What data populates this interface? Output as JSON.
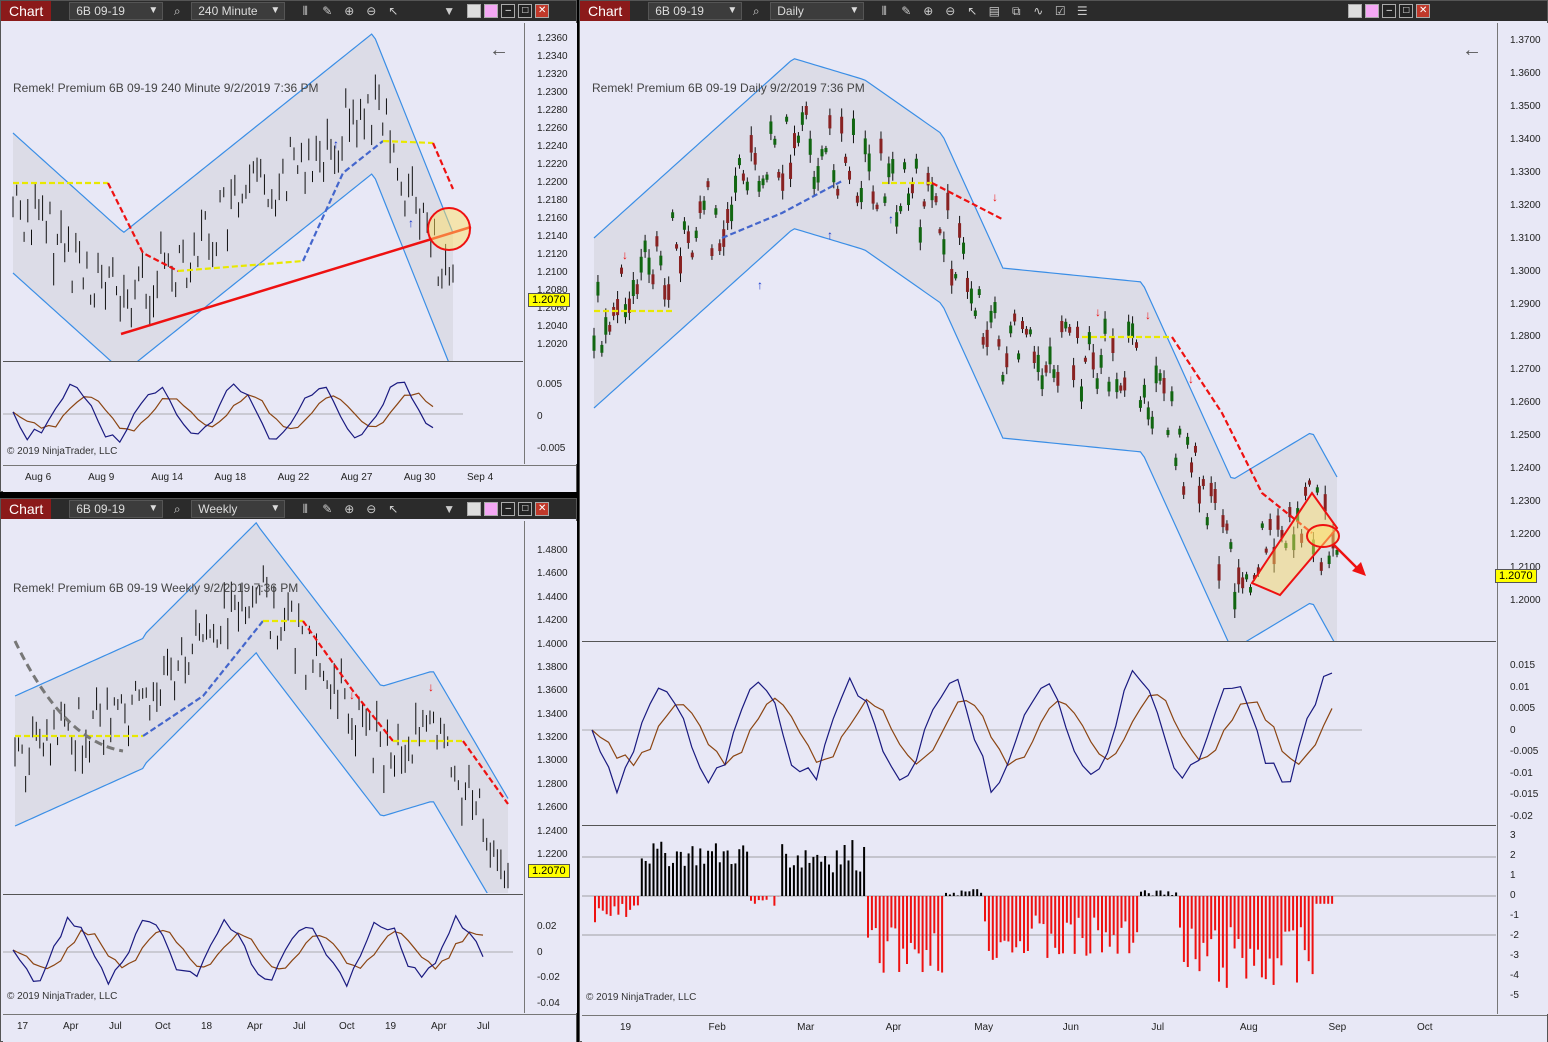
{
  "colors": {
    "band": "#3a8ee6",
    "downtrend": "#ee1111",
    "uptrend": "#4466cc",
    "neutral": "#e8e800",
    "accent": "#8b1a1a",
    "osc_fast": "#1a1a80",
    "osc_slow": "#8b4513",
    "hist_pos": "#000000",
    "hist_neg": "#ee1111"
  },
  "icons": [
    "search-icon",
    "bar-style-icon",
    "draw-icon",
    "zoom-in-icon",
    "zoom-out-icon",
    "cursor-icon",
    "chevron-down-icon",
    "minimize-icon",
    "maximize-icon",
    "close-icon",
    "back-arrow-icon"
  ],
  "win1": {
    "title": "Chart",
    "instrument": "6B 09-19",
    "interval": "240 Minute",
    "label": "Remek!  Premium  6B 09-19  240 Minute  9/2/2019 7:36 PM",
    "copyright": "© 2019 NinjaTrader, LLC",
    "price_badge": "1.2070",
    "y_ticks": [
      "1.2360",
      "1.2340",
      "1.2320",
      "1.2300",
      "1.2280",
      "1.2260",
      "1.2240",
      "1.2220",
      "1.2200",
      "1.2180",
      "1.2160",
      "1.2140",
      "1.2120",
      "1.2100",
      "1.2080",
      "1.2060",
      "1.2040",
      "1.2020"
    ],
    "osc_ticks": [
      "0.005",
      "0",
      "-0.005"
    ],
    "x_ticks": [
      "Aug 6",
      "Aug 9",
      "Aug 14",
      "Aug 18",
      "Aug 22",
      "Aug 27",
      "Aug 30",
      "Sep 4"
    ]
  },
  "win2": {
    "title": "Chart",
    "instrument": "6B 09-19",
    "interval": "Weekly",
    "label": "Remek!  Premium  6B 09-19  Weekly  9/2/2019 7:36 PM",
    "copyright": "© 2019 NinjaTrader, LLC",
    "price_badge": "1.2070",
    "y_ticks": [
      "1.4800",
      "1.4600",
      "1.4400",
      "1.4200",
      "1.4000",
      "1.3800",
      "1.3600",
      "1.3400",
      "1.3200",
      "1.3000",
      "1.2800",
      "1.2600",
      "1.2400",
      "1.2200"
    ],
    "osc_ticks": [
      "0.02",
      "0",
      "-0.02",
      "-0.04"
    ],
    "x_ticks": [
      "17",
      "Apr",
      "Jul",
      "Oct",
      "18",
      "Apr",
      "Jul",
      "Oct",
      "19",
      "Apr",
      "Jul"
    ]
  },
  "win3": {
    "title": "Chart",
    "instrument": "6B 09-19",
    "interval": "Daily",
    "label": "Remek!  Premium  6B 09-19  Daily  9/2/2019 7:36 PM",
    "copyright": "© 2019 NinjaTrader, LLC",
    "price_badge": "1.2070",
    "y_ticks": [
      "1.3700",
      "1.3600",
      "1.3500",
      "1.3400",
      "1.3300",
      "1.3200",
      "1.3100",
      "1.3000",
      "1.2900",
      "1.2800",
      "1.2700",
      "1.2600",
      "1.2500",
      "1.2400",
      "1.2300",
      "1.2200",
      "1.2100",
      "1.2000"
    ],
    "osc_ticks": [
      "0.015",
      "0.01",
      "0.005",
      "0",
      "-0.005",
      "-0.01",
      "-0.015",
      "-0.02"
    ],
    "hist_ticks": [
      "3",
      "2",
      "1",
      "0",
      "-1",
      "-2",
      "-3",
      "-4",
      "-5"
    ],
    "x_ticks": [
      "19",
      "Feb",
      "Mar",
      "Apr",
      "May",
      "Jun",
      "Jul",
      "Aug",
      "Sep",
      "Oct"
    ]
  }
}
